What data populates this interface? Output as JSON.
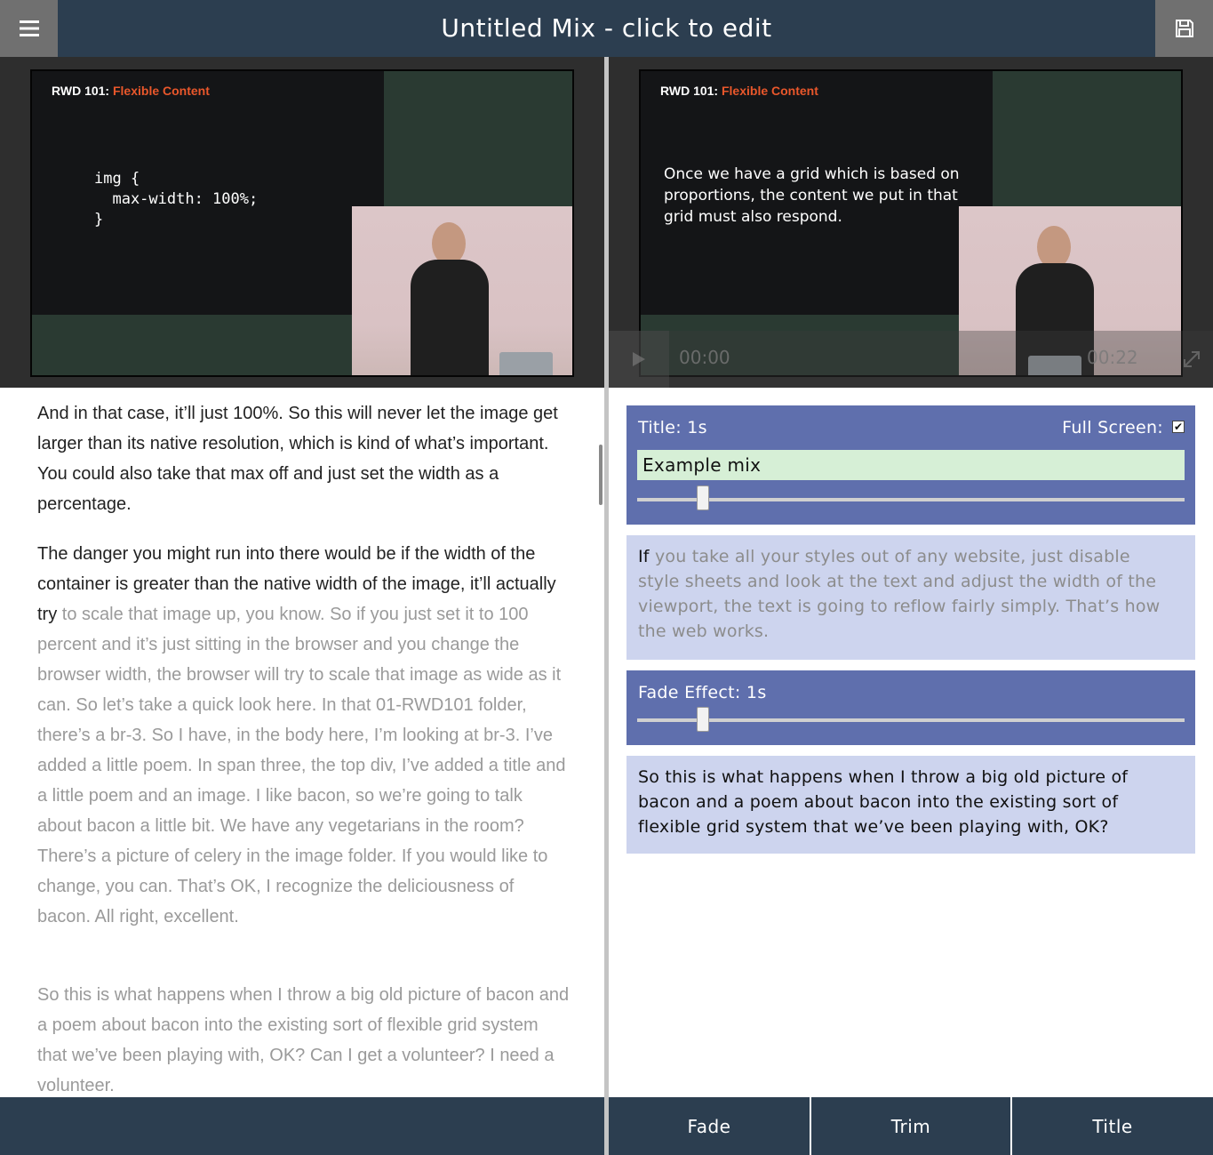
{
  "header": {
    "title": "Untitled Mix - click to edit",
    "menu_icon": "hamburger-icon",
    "save_icon": "floppy-disk-icon"
  },
  "video_left": {
    "slide_prefix": "RWD 101:",
    "slide_accent": "Flexible Content",
    "code": "img {\n  max-width: 100%;\n}"
  },
  "video_right": {
    "slide_prefix": "RWD 101:",
    "slide_accent": "Flexible Content",
    "slide_text": "Once we have a grid which is based on proportions, the content we put in that grid must also respond.",
    "current_time": "00:00",
    "duration": "00:22"
  },
  "transcript": {
    "p1": "And in that case, it’ll just 100%. So this will never let the image get larger than its native resolution, which is kind of what’s important. You could also take that max off and just set the width as a percentage.",
    "p2_dark": "The danger you might run into there would be if the width of the container is greater than the native width of the image, it’ll actually try",
    "p2_light": " to scale that image up, you know. So if you just set it to 100 percent and it’s just sitting in the browser and you change the browser width, the browser will try to scale that image as wide as it can. So let’s take a quick look here. In that 01-RWD101 folder, there’s a br-3.  So I have, in the body here, I’m looking at br-3. I’ve added a little poem. In span three, the top div, I’ve added a title and a little poem and an image.  I like bacon, so we’re going to talk about bacon a little bit. We have any vegetarians in the room? There’s a picture of celery in the image folder. If you would like to change, you can. That’s OK, I recognize the deliciousness of bacon. All right, excellent.",
    "p3": "So this is what happens when I throw a big old picture of bacon and a poem about bacon into the existing sort of flexible grid system that we’ve been playing with, OK? Can I get a volunteer? I need a volunteer."
  },
  "cards": {
    "title_card": {
      "label": "Title: 1s",
      "fullscreen_label": "Full Screen:",
      "fullscreen_checked": true,
      "input_value": "Example mix",
      "slider_value": 0.12
    },
    "clip1": {
      "text_dark": "If",
      "text_light": " you take all your styles out of any website, just disable style sheets and look at the text and adjust the width of the viewport, the text is going to reflow fairly simply. That’s how the web works."
    },
    "fade_card": {
      "label": "Fade Effect: 1s",
      "slider_value": 0.12
    },
    "clip2": {
      "text": "So this is what happens when I throw a big old picture of bacon and a poem about bacon into the existing sort of flexible grid system that we’ve been playing with, OK?"
    }
  },
  "footer": {
    "fade": "Fade",
    "trim": "Trim",
    "title": "Title"
  },
  "colors": {
    "header_bg": "#2c3e50",
    "card_dark": "#5f6fad",
    "card_light": "#cdd4ee",
    "accent": "#e9572b",
    "input_bg": "#d6efd6"
  }
}
